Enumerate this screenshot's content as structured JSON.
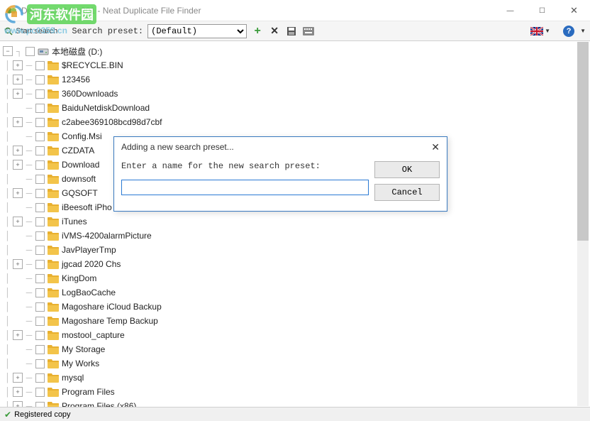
{
  "window": {
    "title": "Detwinner 2.04.001 - Neat Duplicate File Finder",
    "min": "—",
    "max": "☐",
    "close": "✕"
  },
  "watermark": {
    "text": "河东软件园",
    "url": "www.pc0359.cn"
  },
  "toolbar": {
    "start_search": "Start search",
    "preset_label": "Search preset:",
    "preset_value": "(Default)",
    "help": "?"
  },
  "tree": {
    "root": "本地磁盘 (D:)",
    "items": [
      {
        "label": "$RECYCLE.BIN",
        "exp": "+"
      },
      {
        "label": "123456",
        "exp": "+"
      },
      {
        "label": "360Downloads",
        "exp": "+"
      },
      {
        "label": "BaiduNetdiskDownload",
        "exp": ""
      },
      {
        "label": "c2abee369108bcd98d7cbf",
        "exp": "+"
      },
      {
        "label": "Config.Msi",
        "exp": ""
      },
      {
        "label": "CZDATA",
        "exp": "+"
      },
      {
        "label": "Download",
        "exp": "+"
      },
      {
        "label": "downsoft",
        "exp": ""
      },
      {
        "label": "GQSOFT",
        "exp": "+"
      },
      {
        "label": "iBeesoft iPho",
        "exp": ""
      },
      {
        "label": "iTunes",
        "exp": "+"
      },
      {
        "label": "iVMS-4200alarmPicture",
        "exp": ""
      },
      {
        "label": "JavPlayerTmp",
        "exp": ""
      },
      {
        "label": "jgcad 2020 Chs",
        "exp": "+"
      },
      {
        "label": "KingDom",
        "exp": ""
      },
      {
        "label": "LogBaoCache",
        "exp": ""
      },
      {
        "label": "Magoshare iCloud Backup",
        "exp": ""
      },
      {
        "label": "Magoshare Temp Backup",
        "exp": ""
      },
      {
        "label": "mostool_capture",
        "exp": "+"
      },
      {
        "label": "My Storage",
        "exp": ""
      },
      {
        "label": "My Works",
        "exp": ""
      },
      {
        "label": "mysql",
        "exp": "+"
      },
      {
        "label": "Program Files",
        "exp": "+"
      },
      {
        "label": "Program Files (x86)",
        "exp": "+"
      }
    ]
  },
  "dialog": {
    "title": "Adding a new search preset...",
    "prompt": "Enter a name for the new search preset:",
    "value": "",
    "ok": "OK",
    "cancel": "Cancel",
    "close": "✕"
  },
  "status": {
    "text": "Registered copy"
  }
}
